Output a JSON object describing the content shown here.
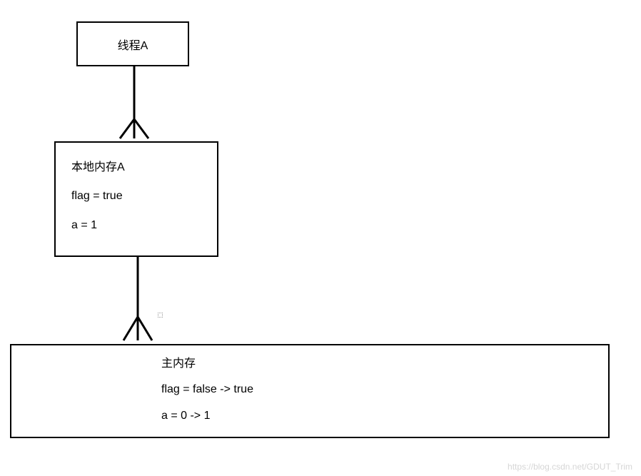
{
  "boxes": {
    "thread": {
      "title": "线程A"
    },
    "local": {
      "title": "本地内存A",
      "line1": "flag = true",
      "line2": "a = 1"
    },
    "main": {
      "title": "主内存",
      "line1": "flag = false -> true",
      "line2": "a = 0 -> 1"
    }
  },
  "watermark": "https://blog.csdn.net/GDUT_Trim"
}
